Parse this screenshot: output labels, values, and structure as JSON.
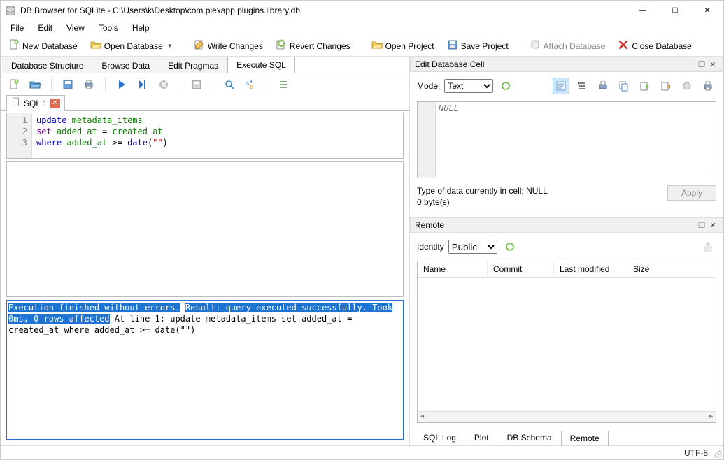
{
  "window": {
    "title": "DB Browser for SQLite - C:\\Users\\k\\Desktop\\com.plexapp.plugins.library.db"
  },
  "menu": [
    "File",
    "Edit",
    "View",
    "Tools",
    "Help"
  ],
  "toolbar": {
    "new_db": "New Database",
    "open_db": "Open Database",
    "write_changes": "Write Changes",
    "revert_changes": "Revert Changes",
    "open_project": "Open Project",
    "save_project": "Save Project",
    "attach_db": "Attach Database",
    "close_db": "Close Database"
  },
  "main_tabs": {
    "items": [
      "Database Structure",
      "Browse Data",
      "Edit Pragmas",
      "Execute SQL"
    ],
    "active_index": 3
  },
  "sql": {
    "tab_label": "SQL 1",
    "lines": [
      "1",
      "2",
      "3"
    ],
    "code": {
      "l1a": "update",
      "l1b": "metadata_items",
      "l2a": "set",
      "l2b": "added_at",
      "l2c": "=",
      "l2d": "created_at",
      "l3a": "where",
      "l3b": "added_at",
      "l3c": ">=",
      "l3d": "date",
      "l3e": "(",
      "l3f": "\"\"",
      "l3g": ")"
    }
  },
  "output": {
    "hl1": "Execution finished without errors.",
    "hl2": "Result: query executed successfully. Took 0ms, 0 rows affected",
    "l3": "At line 1:",
    "l4": "update metadata_items",
    "l5": "set added_at = created_at",
    "l6": "where added_at >= date(\"\")"
  },
  "editcell": {
    "title": "Edit Database Cell",
    "mode_label": "Mode:",
    "mode_value": "Text",
    "null_text": "NULL",
    "info_line1": "Type of data currently in cell: NULL",
    "info_line2": "0 byte(s)",
    "apply_label": "Apply"
  },
  "remote": {
    "title": "Remote",
    "identity_label": "Identity",
    "identity_value": "Public",
    "cols": {
      "name": "Name",
      "commit": "Commit",
      "last_modified": "Last modified",
      "size": "Size"
    }
  },
  "bottom_tabs": {
    "items": [
      "SQL Log",
      "Plot",
      "DB Schema",
      "Remote"
    ],
    "active_index": 3
  },
  "status": {
    "encoding": "UTF-8"
  }
}
